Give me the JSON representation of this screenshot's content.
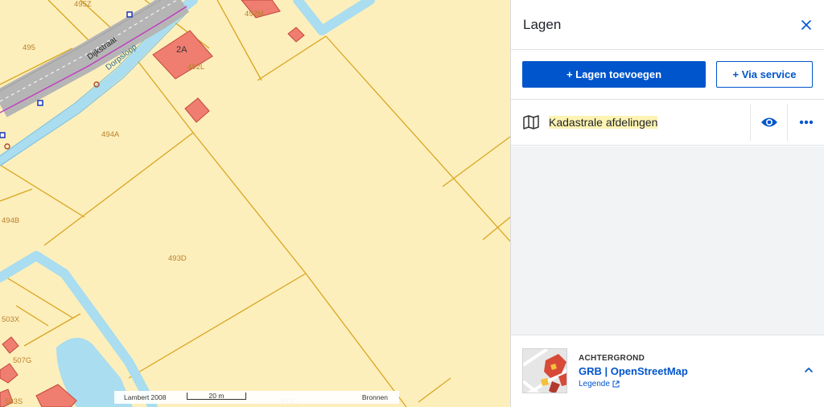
{
  "map": {
    "street_label": "Dijkstraat",
    "water_label": "Dorpsloop",
    "building_label": "2A",
    "parcel_labels": {
      "p1": "495",
      "p2": "492M",
      "p3": "492L",
      "p4": "494A",
      "p5": "494B",
      "p6": "493D",
      "p7": "503X",
      "p8": "507G",
      "p9": "503S",
      "p10": "493C",
      "p11": "495Z"
    },
    "scalebar": {
      "projection": "Lambert 2008",
      "distance": "20 m",
      "sources": "Bronnen"
    }
  },
  "panel": {
    "title": "Lagen",
    "add_layers_label": "+ Lagen toevoegen",
    "via_service_label": "+ Via service",
    "layers": [
      {
        "name": "Kadastrale afdelingen",
        "icon": "map-icon",
        "visible": true
      }
    ],
    "background": {
      "caption": "ACHTERGROND",
      "name": "GRB | OpenStreetMap",
      "legend_label": "Legende"
    }
  },
  "colors": {
    "accent": "#0055cc",
    "parcel_fill": "#fdefbc",
    "parcel_line": "#d9a520",
    "water": "#a9ddef",
    "building": "#ef7d70",
    "road": "#b5b5b5",
    "highlight": "#fdf3b3"
  }
}
